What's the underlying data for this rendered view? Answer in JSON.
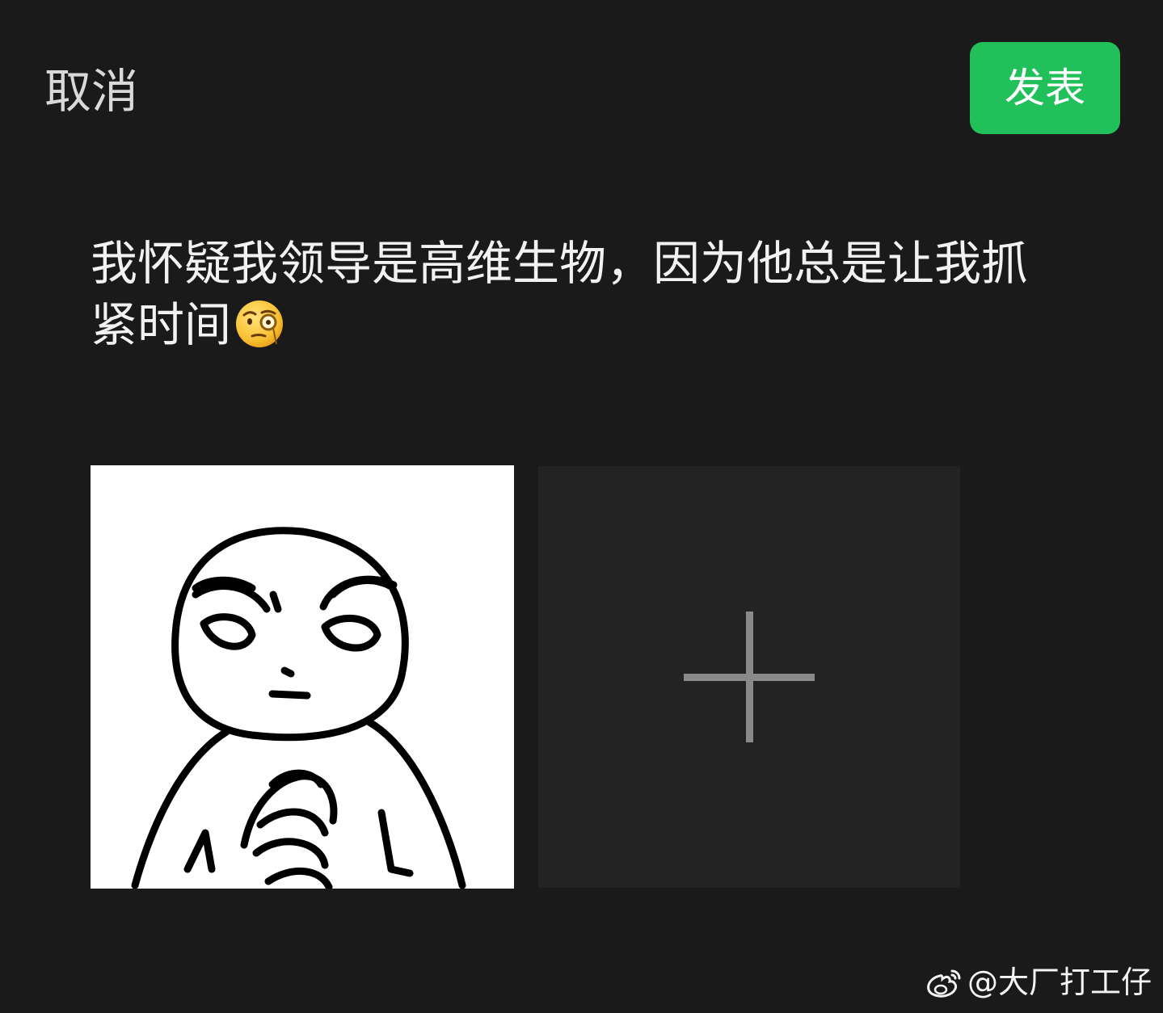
{
  "header": {
    "cancel_label": "取消",
    "publish_label": "发表",
    "publish_color": "#22c05a"
  },
  "post": {
    "text": "我怀疑我领导是高维生物，因为他总是让我抓紧时间",
    "emoji": "monocle-face-icon"
  },
  "media": {
    "image": "meme-clasped-hands-image",
    "add_icon": "plus-icon"
  },
  "watermark": {
    "logo": "weibo-logo-icon",
    "text": "@大厂打工仔"
  }
}
